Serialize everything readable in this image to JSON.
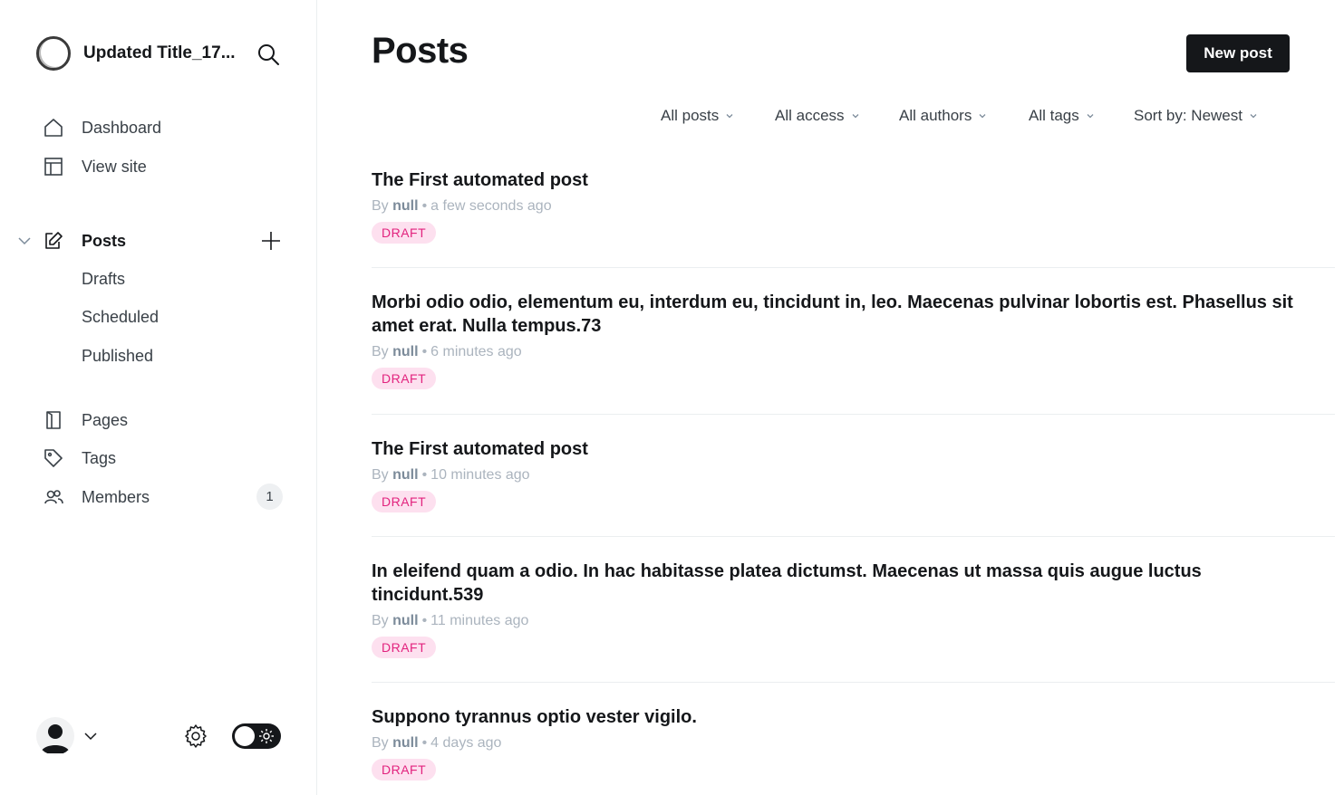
{
  "site": {
    "title": "Updated Title_17..."
  },
  "nav": {
    "dashboard": "Dashboard",
    "view_site": "View site",
    "posts": "Posts",
    "drafts": "Drafts",
    "scheduled": "Scheduled",
    "published": "Published",
    "pages": "Pages",
    "tags": "Tags",
    "members": "Members",
    "members_count": "1"
  },
  "icons": {
    "search": "search-icon",
    "home": "home-icon",
    "view_site": "layout-icon",
    "posts": "edit-icon",
    "pages": "page-icon",
    "tags": "tag-icon",
    "members": "members-icon",
    "settings": "gear-icon",
    "theme": "sun-icon"
  },
  "header": {
    "title": "Posts",
    "new_post": "New post"
  },
  "filters": {
    "type": "All posts",
    "access": "All access",
    "authors": "All authors",
    "tags": "All tags",
    "sort": "Sort by: Newest"
  },
  "posts": [
    {
      "title": "The First automated post",
      "by": "By",
      "author": "null",
      "dot": "•",
      "time": "a few seconds ago",
      "status": "DRAFT"
    },
    {
      "title": "Morbi odio odio, elementum eu, interdum eu, tincidunt in, leo. Maecenas pulvinar lobortis est. Phasellus sit amet erat. Nulla tempus.73",
      "by": "By",
      "author": "null",
      "dot": "•",
      "time": "6 minutes ago",
      "status": "DRAFT"
    },
    {
      "title": "The First automated post",
      "by": "By",
      "author": "null",
      "dot": "•",
      "time": "10 minutes ago",
      "status": "DRAFT"
    },
    {
      "title": "In eleifend quam a odio. In hac habitasse platea dictumst. Maecenas ut massa quis augue luctus tincidunt.539",
      "by": "By",
      "author": "null",
      "dot": "•",
      "time": "11 minutes ago",
      "status": "DRAFT"
    },
    {
      "title": "Suppono tyrannus optio vester vigilo.",
      "by": "By",
      "author": "null",
      "dot": "•",
      "time": "4 days ago",
      "status": "DRAFT"
    }
  ],
  "colors": {
    "accent": "#15171a",
    "draft_bg": "#fde0ef",
    "draft_text": "#e2237e"
  }
}
